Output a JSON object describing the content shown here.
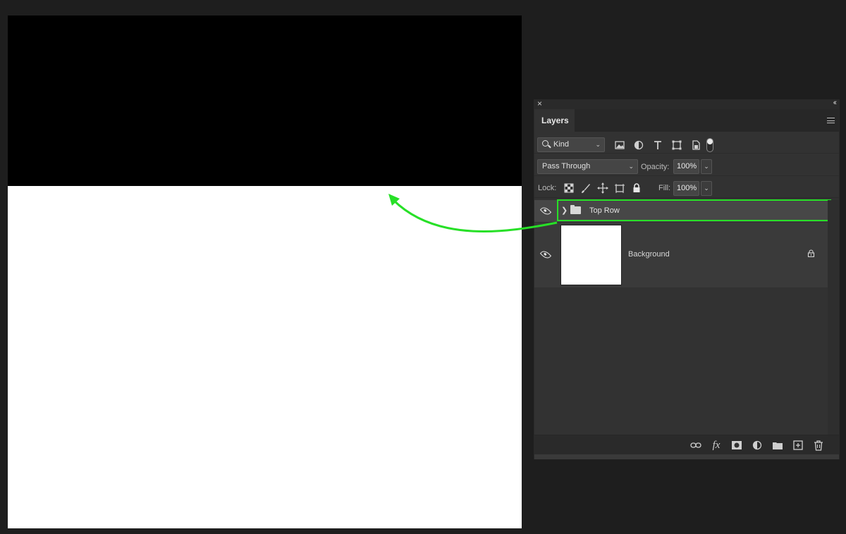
{
  "canvas": {
    "top_fill_color": "#000000",
    "bottom_fill_color": "#ffffff"
  },
  "panel": {
    "tab_title": "Layers",
    "close_icon": "close-icon",
    "collapse_icon": "collapse-icon",
    "menu_icon": "panel-menu-icon",
    "filter": {
      "kind_label": "Kind",
      "icons": [
        "image-filter-icon",
        "adjustment-filter-icon",
        "type-filter-icon",
        "shape-filter-icon",
        "smart-object-filter-icon"
      ]
    },
    "blend_mode": "Pass Through",
    "opacity_label": "Opacity:",
    "opacity_value": "100%",
    "lock_label": "Lock:",
    "lock_icons": [
      "lock-transparent-icon",
      "lock-image-icon",
      "lock-position-icon",
      "lock-artboard-icon",
      "lock-all-icon"
    ],
    "fill_label": "Fill:",
    "fill_value": "100%",
    "layers": [
      {
        "name": "Top Row",
        "type": "group",
        "visible": true,
        "selected": true
      },
      {
        "name": "Background",
        "type": "background",
        "visible": true,
        "locked": true
      }
    ],
    "bottom_icons": [
      "link-layers-icon",
      "fx-icon",
      "mask-icon",
      "adjustment-layer-icon",
      "new-group-icon",
      "new-layer-icon",
      "delete-icon"
    ]
  },
  "annotation": {
    "highlight_color": "#27e027",
    "arrow_color": "#27e027"
  }
}
